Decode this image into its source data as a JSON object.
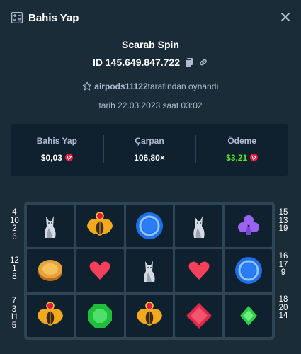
{
  "header": {
    "title": "Bahis Yap",
    "icon": "bet-slip-icon",
    "close_icon": "close-icon"
  },
  "game": {
    "title": "Scarab Spin",
    "id_text": "ID 145.649.847.722",
    "played_by_user": "airpods11122",
    "played_by_suffix": "tarafından oynandı",
    "date_text": "tarih 22.03.2023 saat 03:02"
  },
  "stats": {
    "bet_label": "Bahis Yap",
    "bet_value": "$0,03",
    "multiplier_label": "Çarpan",
    "multiplier_value": "106,80×",
    "payout_label": "Ödeme",
    "payout_value": "$3,21"
  },
  "colors": {
    "background": "#1a2c38",
    "panel": "#0f212e",
    "border": "#2f4553",
    "muted": "#b1bad3",
    "win": "#5ae12b",
    "coin": "#e8183d"
  },
  "paylines": {
    "left": [
      [
        "4",
        "10",
        "2",
        "6"
      ],
      [
        "12",
        "1",
        "8"
      ],
      [
        "7",
        "3",
        "11",
        "5"
      ]
    ],
    "right": [
      [
        "15",
        "13",
        "19"
      ],
      [
        "16",
        "17",
        "9"
      ],
      [
        "18",
        "20",
        "14"
      ]
    ]
  },
  "reels": [
    [
      "cat-statue",
      "scarab",
      "blue-ring",
      "cat-statue",
      "club"
    ],
    [
      "gold-coin",
      "heart",
      "cat-statue",
      "heart",
      "blue-ring"
    ],
    [
      "scarab",
      "green-gem",
      "scarab",
      "red-diamond",
      "green-diamond"
    ]
  ]
}
